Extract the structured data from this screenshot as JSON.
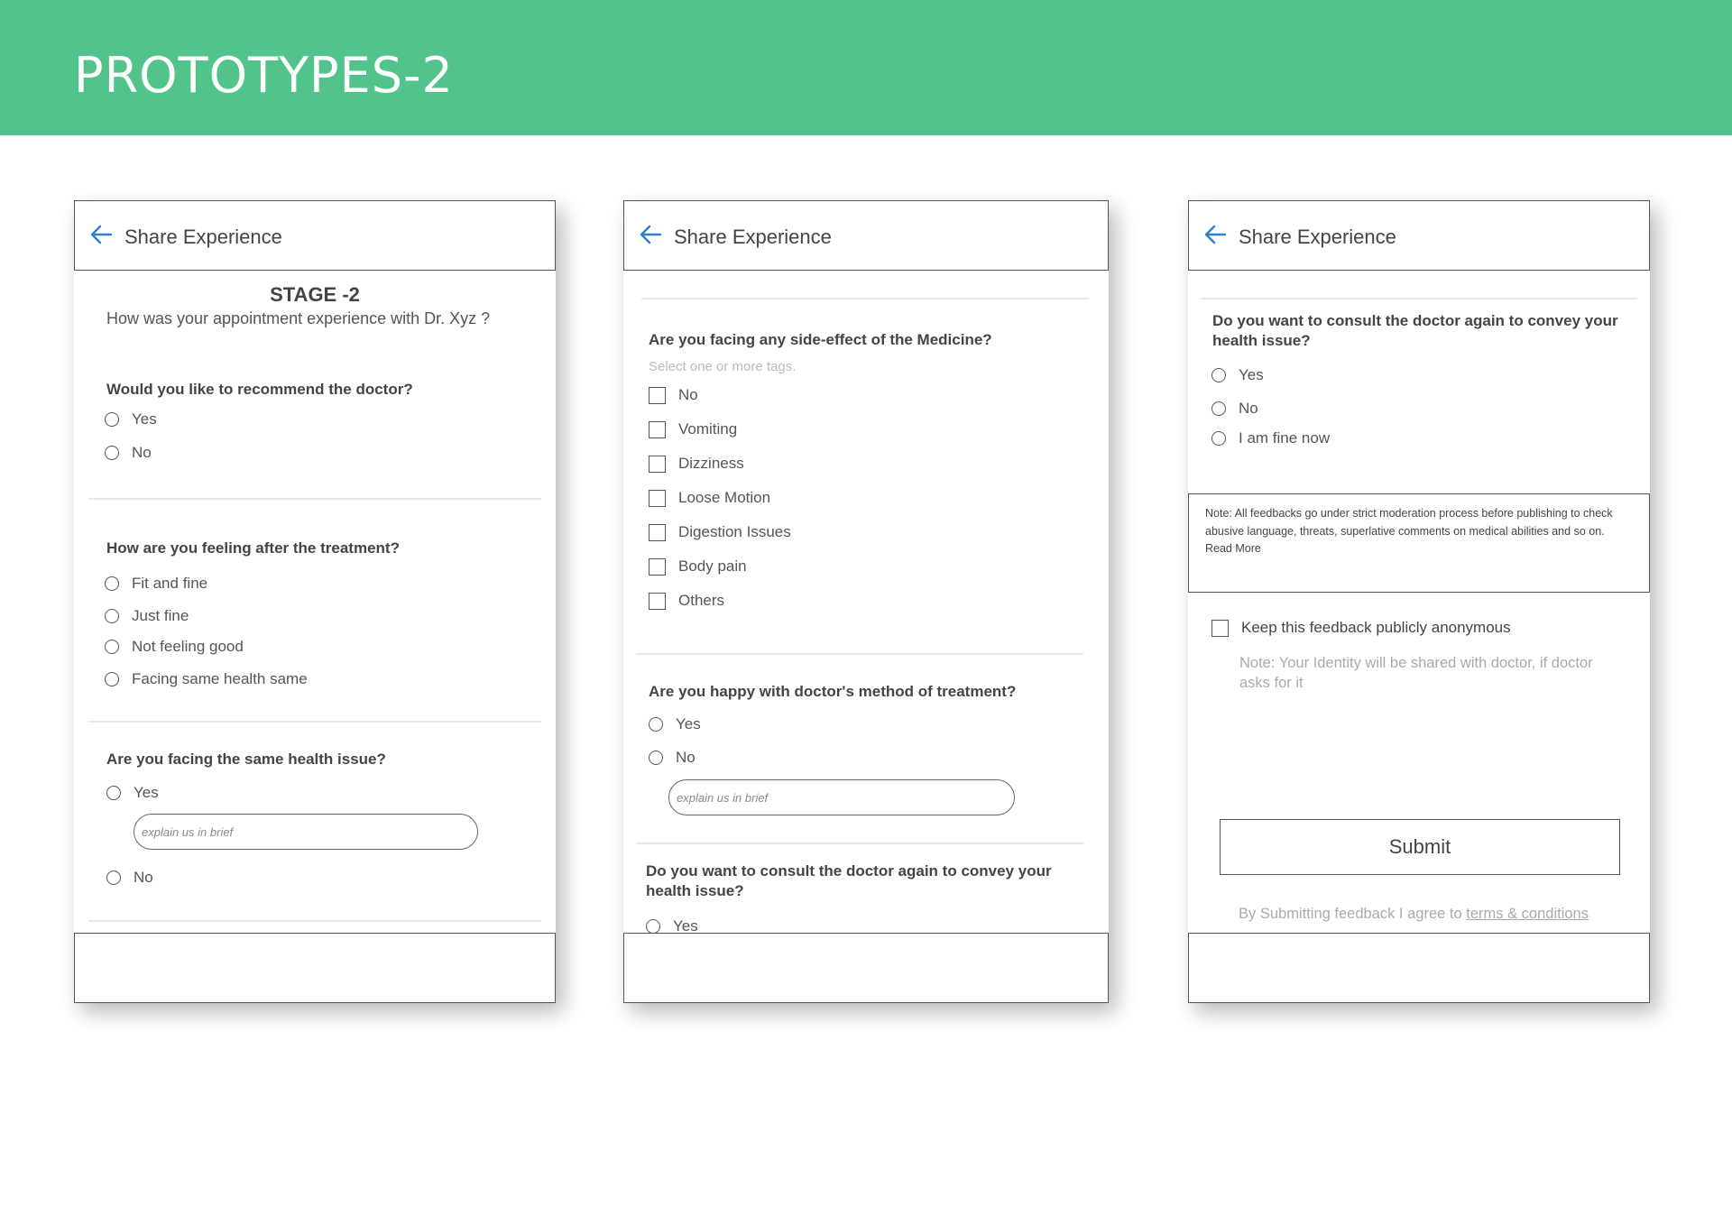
{
  "page": {
    "title": "PROTOTYPES-2",
    "accent_color": "#52c38a"
  },
  "screens": [
    {
      "header": {
        "back_icon": "arrow-left-icon",
        "title": "Share Experience"
      },
      "stage": "STAGE -2",
      "intro": "How was your appointment experience with Dr. Xyz ?",
      "q_recommend": {
        "label": "Would you like to recommend the doctor?",
        "options": [
          "Yes",
          "No"
        ]
      },
      "q_feeling": {
        "label": "How are you feeling after the treatment?",
        "options": [
          "Fit and fine",
          "Just fine",
          "Not feeling good",
          "Facing same health same"
        ]
      },
      "q_same_issue": {
        "label": "Are you facing the same health issue?",
        "options": [
          "Yes",
          "No"
        ],
        "placeholder": "explain us in brief"
      }
    },
    {
      "header": {
        "back_icon": "arrow-left-icon",
        "title": "Share Experience"
      },
      "q_side_effect": {
        "label": "Are you facing any side-effect of the Medicine?",
        "hint": "Select one or more tags.",
        "options": [
          "No",
          "Vomiting",
          "Dizziness",
          "Loose Motion",
          "Digestion Issues",
          "Body pain",
          "Others"
        ]
      },
      "q_happy": {
        "label": "Are you happy with doctor's method of treatment?",
        "options": [
          "Yes",
          "No"
        ],
        "placeholder": "explain us in brief"
      },
      "q_consult": {
        "label": "Do you want to consult the doctor again to convey your health issue?",
        "options": [
          "Yes"
        ]
      }
    },
    {
      "header": {
        "back_icon": "arrow-left-icon",
        "title": "Share Experience"
      },
      "q_consult": {
        "label": "Do you want to consult the doctor again to convey your health issue?",
        "options": [
          "Yes",
          "No",
          "I am fine now"
        ]
      },
      "note": {
        "prefix": "Note:",
        "text": "All feedbacks go under strict moderation process before publishing to check abusive language, threats, superlative comments on medical abilities and so on.",
        "read_more": "Read More"
      },
      "anonymous": {
        "label": "Keep this feedback publicly anonymous",
        "note": "Note: Your Identity will be shared with doctor, if doctor asks for it"
      },
      "submit_label": "Submit",
      "agree": {
        "text": "By Submitting feedback I agree to",
        "link": "terms & conditions"
      }
    }
  ]
}
